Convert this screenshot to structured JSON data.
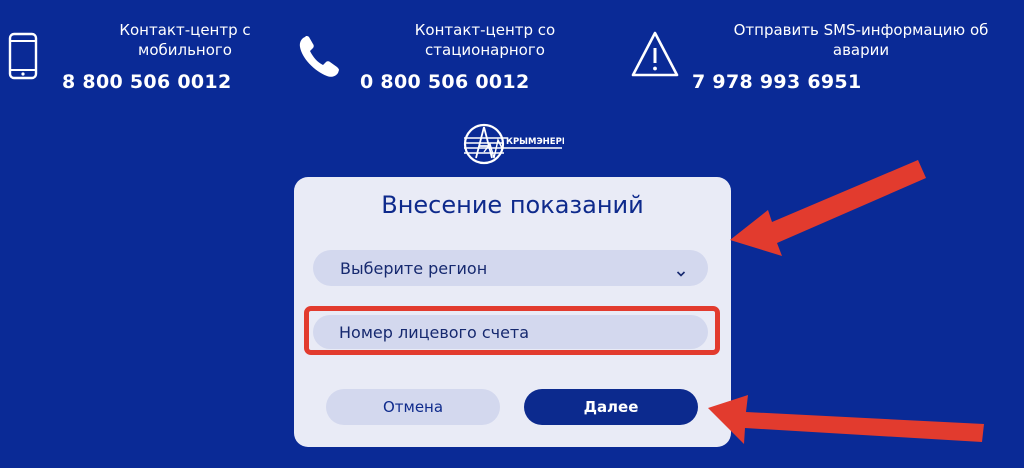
{
  "contacts": [
    {
      "label": "Контакт-центр с мобильного",
      "phone": "8 800 506 0012",
      "icon": "mobile-phone-icon"
    },
    {
      "label": "Контакт-центр со стационарного",
      "phone": "0 800 506 0012",
      "icon": "telephone-handset-icon"
    },
    {
      "label": "Отправить SMS-информацию об аварии",
      "phone": "7 978 993 6951",
      "icon": "warning-triangle-icon"
    }
  ],
  "logo": {
    "text": "КРЫМЭНЕРГО"
  },
  "form": {
    "title": "Внесение показаний",
    "region_select": {
      "value": "Выберите регион"
    },
    "account_input": {
      "placeholder": "Номер лицевого счета",
      "value": ""
    },
    "cancel_label": "Отмена",
    "next_label": "Далее"
  },
  "colors": {
    "background": "#0a2a96",
    "card": "#e9ebf6",
    "field": "#d3d8ee",
    "primary_button": "#0c2a8e",
    "annotation": "#e23b2e"
  }
}
